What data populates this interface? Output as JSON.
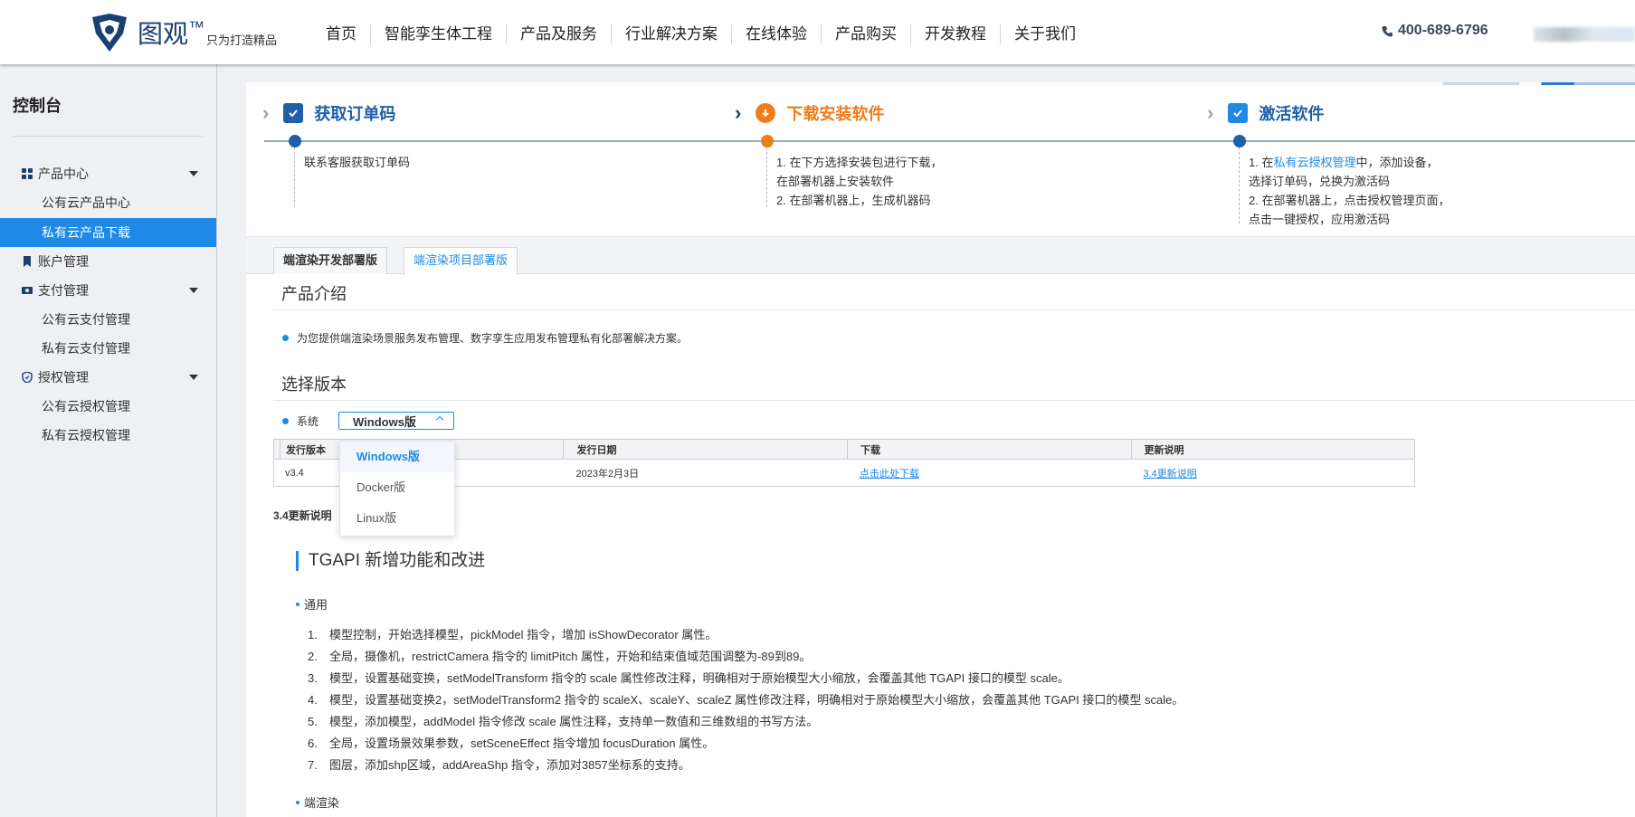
{
  "header": {
    "brand_name": "图观",
    "brand_tm": "™",
    "slogan": "只为打造精品",
    "nav": [
      "首页",
      "智能孪生体工程",
      "产品及服务",
      "行业解决方案",
      "在线体验",
      "产品购买",
      "开发教程",
      "关于我们"
    ],
    "phone": "400-689-6796"
  },
  "sidebar": {
    "title": "控制台",
    "items": [
      {
        "label": "产品中心"
      },
      {
        "label": "公有云产品中心"
      },
      {
        "label": "私有云产品下载"
      },
      {
        "label": "账户管理"
      },
      {
        "label": "支付管理"
      },
      {
        "label": "公有云支付管理"
      },
      {
        "label": "私有云支付管理"
      },
      {
        "label": "授权管理"
      },
      {
        "label": "公有云授权管理"
      },
      {
        "label": "私有云授权管理"
      }
    ]
  },
  "steps": [
    {
      "title": "获取订单码",
      "desc": [
        "联系客服获取订单码"
      ]
    },
    {
      "title": "下载安装软件",
      "desc": [
        "1. 在下方选择安装包进行下载，",
        "在部署机器上安装软件",
        "2. 在部署机器上，生成机器码"
      ]
    },
    {
      "title": "激活软件",
      "desc_prefix": "1. 在",
      "desc_link": "私有云授权管理",
      "desc_suffix": "中，添加设备，",
      "desc": [
        "选择订单码，兑换为激活码",
        "2. 在部署机器上，点击授权管理页面，",
        "点击一键授权，应用激活码"
      ]
    }
  ],
  "tabs": [
    "端渲染开发部署版",
    "端渲染项目部署版"
  ],
  "intro": {
    "title": "产品介绍",
    "text": "为您提供端渲染场景服务发布管理、数字孪生应用发布管理私有化部署解决方案。"
  },
  "version": {
    "title": "选择版本",
    "system_label": "系统",
    "selected": "Windows版",
    "options": [
      "Windows版",
      "Docker版",
      "Linux版"
    ]
  },
  "table": {
    "headers": [
      "发行版本",
      "发行日期",
      "下载",
      "更新说明"
    ],
    "rows": [
      {
        "version": "v3.4",
        "date": "2023年2月3日",
        "download": "点击此处下载",
        "notes": "3.4更新说明"
      }
    ]
  },
  "notes": {
    "label": "3.4更新说明",
    "heading": "TGAPI 新增功能和改进",
    "cat1": "通用",
    "items": [
      "模型控制，开始选择模型，pickModel 指令，增加 isShowDecorator 属性。",
      "全局，摄像机，restrictCamera 指令的 limitPitch 属性，开始和结束值域范围调整为-89到89。",
      "模型，设置基础变换，setModelTransform 指令的 scale 属性修改注释，明确相对于原始模型大小缩放，会覆盖其他 TGAPI 接口的模型 scale。",
      "模型，设置基础变换2，setModelTransform2 指令的 scaleX、scaleY、scaleZ 属性修改注释，明确相对于原始模型大小缩放，会覆盖其他 TGAPI 接口的模型 scale。",
      "模型，添加模型，addModel 指令修改 scale 属性注释，支持单一数值和三维数组的书写方法。",
      "全局，设置场景效果参数，setSceneEffect 指令增加 focusDuration 属性。",
      "图层，添加shp区域，addAreaShp 指令，添加对3857坐标系的支持。"
    ],
    "cat2": "端渲染"
  },
  "colors": {
    "accent": "#1e8ae6",
    "brand": "#1a3f73",
    "orange": "#ef7d1a"
  }
}
